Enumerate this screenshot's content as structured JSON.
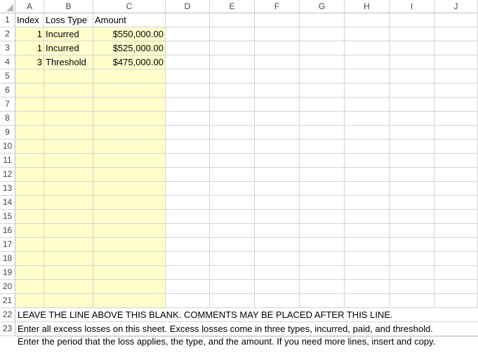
{
  "columns": [
    "A",
    "B",
    "C",
    "D",
    "E",
    "F",
    "G",
    "H",
    "I",
    "J"
  ],
  "rows": [
    "1",
    "2",
    "3",
    "4",
    "5",
    "6",
    "7",
    "8",
    "9",
    "10",
    "11",
    "12",
    "13",
    "14",
    "15",
    "16",
    "17",
    "18",
    "19",
    "20",
    "21",
    "22",
    "23"
  ],
  "header_row": {
    "index": "Index",
    "loss_type": "Loss Type",
    "amount": "Amount"
  },
  "losses": [
    {
      "index": "1",
      "type": "Incurred",
      "amount": "$550,000.00"
    },
    {
      "index": "1",
      "type": "Incurred",
      "amount": "$525,000.00"
    },
    {
      "index": "3",
      "type": "Threshold",
      "amount": "$475,000.00"
    }
  ],
  "notes": [
    "LEAVE THE LINE ABOVE THIS BLANK. COMMENTS MAY BE PLACED AFTER THIS LINE.",
    "Enter all excess losses on this sheet. Excess losses come in three types, incurred, paid, and threshold.",
    "Enter the period that the loss applies, the type, and the amount. If you need more lines, insert and copy."
  ],
  "colors": {
    "input_fill": "#ffffcc",
    "gridline": "#d4d4d4",
    "header_text": "#444444"
  }
}
